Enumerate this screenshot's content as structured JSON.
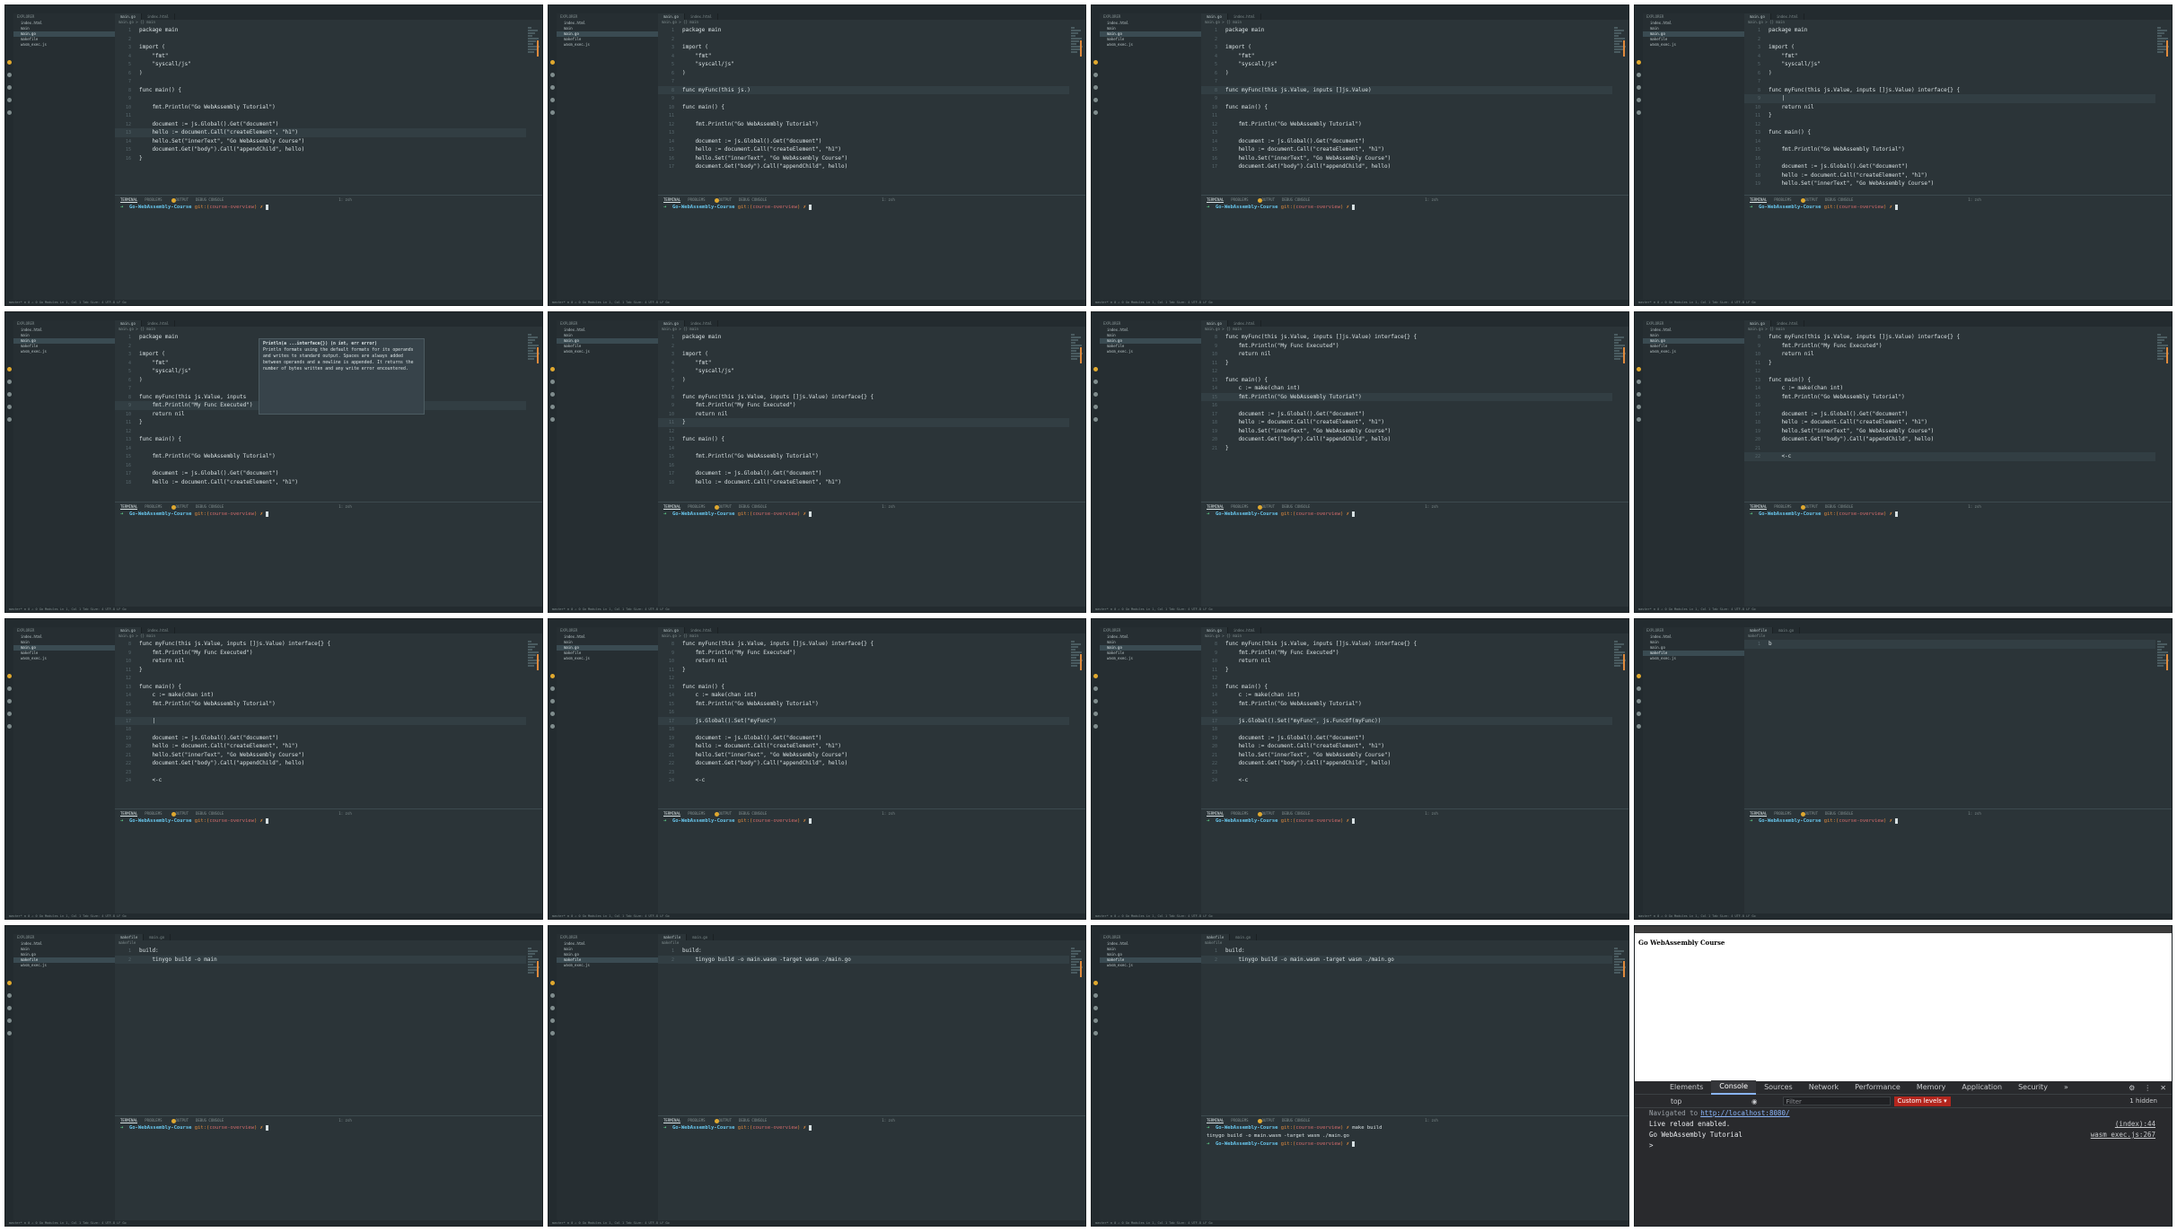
{
  "sidebar_files": [
    "index.html",
    "main",
    "main.go",
    "makefile",
    "wasm_exec.js"
  ],
  "frames": [
    {
      "tab_main": "main.go",
      "tab_other": "index.html",
      "crumbs": "main.go > {} main",
      "code": [
        {
          "n": "1",
          "t": "package main"
        },
        {
          "n": "2",
          "t": ""
        },
        {
          "n": "3",
          "t": "import ("
        },
        {
          "n": "4",
          "t": "    \"fmt\""
        },
        {
          "n": "5",
          "t": "    \"syscall/js\""
        },
        {
          "n": "6",
          "t": ")"
        },
        {
          "n": "7",
          "t": ""
        },
        {
          "n": "8",
          "t": "func main() {"
        },
        {
          "n": "9",
          "t": ""
        },
        {
          "n": "10",
          "t": "    fmt.Println(\"Go WebAssembly Tutorial\")"
        },
        {
          "n": "11",
          "t": ""
        },
        {
          "n": "12",
          "t": "    document := js.Global().Get(\"document\")"
        },
        {
          "n": "13",
          "t": "    hello := document.Call(\"createElement\", \"h1\")"
        },
        {
          "n": "14",
          "t": "    hello.Set(\"innerText\", \"Go WebAssembly Course\")"
        },
        {
          "n": "15",
          "t": "    document.Get(\"body\").Call(\"appendChild\", hello)"
        },
        {
          "n": "16",
          "t": "}"
        }
      ],
      "highlight": 13
    },
    {
      "tab_main": "main.go",
      "tab_other": "index.html",
      "crumbs": "main.go > {} main",
      "code": [
        {
          "n": "1",
          "t": "package main"
        },
        {
          "n": "2",
          "t": ""
        },
        {
          "n": "3",
          "t": "import ("
        },
        {
          "n": "4",
          "t": "    \"fmt\""
        },
        {
          "n": "5",
          "t": "    \"syscall/js\""
        },
        {
          "n": "6",
          "t": ")"
        },
        {
          "n": "7",
          "t": ""
        },
        {
          "n": "8",
          "t": "func myFunc(this js.)"
        },
        {
          "n": "9",
          "t": ""
        },
        {
          "n": "10",
          "t": "func main() {"
        },
        {
          "n": "11",
          "t": ""
        },
        {
          "n": "12",
          "t": "    fmt.Println(\"Go WebAssembly Tutorial\")"
        },
        {
          "n": "13",
          "t": ""
        },
        {
          "n": "14",
          "t": "    document := js.Global().Get(\"document\")"
        },
        {
          "n": "15",
          "t": "    hello := document.Call(\"createElement\", \"h1\")"
        },
        {
          "n": "16",
          "t": "    hello.Set(\"innerText\", \"Go WebAssembly Course\")"
        },
        {
          "n": "17",
          "t": "    document.Get(\"body\").Call(\"appendChild\", hello)"
        }
      ],
      "highlight": 8
    },
    {
      "tab_main": "main.go",
      "tab_other": "index.html",
      "crumbs": "main.go > {} main",
      "code": [
        {
          "n": "1",
          "t": "package main"
        },
        {
          "n": "2",
          "t": ""
        },
        {
          "n": "3",
          "t": "import ("
        },
        {
          "n": "4",
          "t": "    \"fmt\""
        },
        {
          "n": "5",
          "t": "    \"syscall/js\""
        },
        {
          "n": "6",
          "t": ")"
        },
        {
          "n": "7",
          "t": ""
        },
        {
          "n": "8",
          "t": "func myFunc(this js.Value, inputs []js.Value)"
        },
        {
          "n": "9",
          "t": ""
        },
        {
          "n": "10",
          "t": "func main() {"
        },
        {
          "n": "11",
          "t": ""
        },
        {
          "n": "12",
          "t": "    fmt.Println(\"Go WebAssembly Tutorial\")"
        },
        {
          "n": "13",
          "t": ""
        },
        {
          "n": "14",
          "t": "    document := js.Global().Get(\"document\")"
        },
        {
          "n": "15",
          "t": "    hello := document.Call(\"createElement\", \"h1\")"
        },
        {
          "n": "16",
          "t": "    hello.Set(\"innerText\", \"Go WebAssembly Course\")"
        },
        {
          "n": "17",
          "t": "    document.Get(\"body\").Call(\"appendChild\", hello)"
        }
      ],
      "highlight": 8
    },
    {
      "tab_main": "main.go",
      "tab_other": "index.html",
      "crumbs": "main.go > {} main",
      "code": [
        {
          "n": "1",
          "t": "package main"
        },
        {
          "n": "2",
          "t": ""
        },
        {
          "n": "3",
          "t": "import ("
        },
        {
          "n": "4",
          "t": "    \"fmt\""
        },
        {
          "n": "5",
          "t": "    \"syscall/js\""
        },
        {
          "n": "6",
          "t": ")"
        },
        {
          "n": "7",
          "t": ""
        },
        {
          "n": "8",
          "t": "func myFunc(this js.Value, inputs []js.Value) interface{} {"
        },
        {
          "n": "9",
          "t": "    |"
        },
        {
          "n": "10",
          "t": "    return nil"
        },
        {
          "n": "11",
          "t": "}"
        },
        {
          "n": "12",
          "t": ""
        },
        {
          "n": "13",
          "t": "func main() {"
        },
        {
          "n": "14",
          "t": ""
        },
        {
          "n": "15",
          "t": "    fmt.Println(\"Go WebAssembly Tutorial\")"
        },
        {
          "n": "16",
          "t": ""
        },
        {
          "n": "17",
          "t": "    document := js.Global().Get(\"document\")"
        },
        {
          "n": "18",
          "t": "    hello := document.Call(\"createElement\", \"h1\")"
        },
        {
          "n": "19",
          "t": "    hello.Set(\"innerText\", \"Go WebAssembly Course\")"
        }
      ],
      "highlight": 9
    },
    {
      "tab_main": "main.go",
      "tab_other": "index.html",
      "crumbs": "main.go > {} main",
      "code": [
        {
          "n": "1",
          "t": "package main"
        },
        {
          "n": "2",
          "t": ""
        },
        {
          "n": "3",
          "t": "import ("
        },
        {
          "n": "4",
          "t": "    \"fmt\""
        },
        {
          "n": "5",
          "t": "    \"syscall/js\""
        },
        {
          "n": "6",
          "t": ")"
        },
        {
          "n": "7",
          "t": ""
        },
        {
          "n": "8",
          "t": "func myFunc(this js.Value, inputs"
        },
        {
          "n": "9",
          "t": "    fmt.Println(\"My Func Executed\")"
        },
        {
          "n": "10",
          "t": "    return nil"
        },
        {
          "n": "11",
          "t": "}"
        },
        {
          "n": "12",
          "t": ""
        },
        {
          "n": "13",
          "t": "func main() {"
        },
        {
          "n": "14",
          "t": ""
        },
        {
          "n": "15",
          "t": "    fmt.Println(\"Go WebAssembly Tutorial\")"
        },
        {
          "n": "16",
          "t": ""
        },
        {
          "n": "17",
          "t": "    document := js.Global().Get(\"document\")"
        },
        {
          "n": "18",
          "t": "    hello := document.Call(\"createElement\", \"h1\")"
        }
      ],
      "highlight": 9,
      "tooltip": {
        "signature": "Println(a ...interface{}) (n int, err error)",
        "body": "Println formats using the default formats for its operands and writes to standard output. Spaces are always added between operands and a newline is appended. It returns the number of bytes written and any write error encountered."
      }
    },
    {
      "tab_main": "main.go",
      "tab_other": "index.html",
      "crumbs": "main.go > {} main",
      "code": [
        {
          "n": "1",
          "t": "package main"
        },
        {
          "n": "2",
          "t": ""
        },
        {
          "n": "3",
          "t": "import ("
        },
        {
          "n": "4",
          "t": "    \"fmt\""
        },
        {
          "n": "5",
          "t": "    \"syscall/js\""
        },
        {
          "n": "6",
          "t": ")"
        },
        {
          "n": "7",
          "t": ""
        },
        {
          "n": "8",
          "t": "func myFunc(this js.Value, inputs []js.Value) interface{} {"
        },
        {
          "n": "9",
          "t": "    fmt.Println(\"My Func Executed\")"
        },
        {
          "n": "10",
          "t": "    return nil"
        },
        {
          "n": "11",
          "t": "}"
        },
        {
          "n": "12",
          "t": ""
        },
        {
          "n": "13",
          "t": "func main() {"
        },
        {
          "n": "14",
          "t": ""
        },
        {
          "n": "15",
          "t": "    fmt.Println(\"Go WebAssembly Tutorial\")"
        },
        {
          "n": "16",
          "t": ""
        },
        {
          "n": "17",
          "t": "    document := js.Global().Get(\"document\")"
        },
        {
          "n": "18",
          "t": "    hello := document.Call(\"createElement\", \"h1\")"
        }
      ],
      "highlight": 11
    },
    {
      "tab_main": "main.go",
      "tab_other": "index.html",
      "crumbs": "main.go > {} main",
      "code": [
        {
          "n": "8",
          "t": "func myFunc(this js.Value, inputs []js.Value) interface{} {"
        },
        {
          "n": "9",
          "t": "    fmt.Println(\"My Func Executed\")"
        },
        {
          "n": "10",
          "t": "    return nil"
        },
        {
          "n": "11",
          "t": "}"
        },
        {
          "n": "12",
          "t": ""
        },
        {
          "n": "13",
          "t": "func main() {"
        },
        {
          "n": "14",
          "t": "    c := make(chan int)"
        },
        {
          "n": "15",
          "t": "    fmt.Println(\"Go WebAssembly Tutorial\")"
        },
        {
          "n": "16",
          "t": ""
        },
        {
          "n": "17",
          "t": "    document := js.Global().Get(\"document\")"
        },
        {
          "n": "18",
          "t": "    hello := document.Call(\"createElement\", \"h1\")"
        },
        {
          "n": "19",
          "t": "    hello.Set(\"innerText\", \"Go WebAssembly Course\")"
        },
        {
          "n": "20",
          "t": "    document.Get(\"body\").Call(\"appendChild\", hello)"
        },
        {
          "n": "21",
          "t": "}"
        }
      ],
      "highlight": 15
    },
    {
      "tab_main": "main.go",
      "tab_other": "index.html",
      "crumbs": "main.go > {} main",
      "code": [
        {
          "n": "8",
          "t": "func myFunc(this js.Value, inputs []js.Value) interface{} {"
        },
        {
          "n": "9",
          "t": "    fmt.Println(\"My Func Executed\")"
        },
        {
          "n": "10",
          "t": "    return nil"
        },
        {
          "n": "11",
          "t": "}"
        },
        {
          "n": "12",
          "t": ""
        },
        {
          "n": "13",
          "t": "func main() {"
        },
        {
          "n": "14",
          "t": "    c := make(chan int)"
        },
        {
          "n": "15",
          "t": "    fmt.Println(\"Go WebAssembly Tutorial\")"
        },
        {
          "n": "16",
          "t": ""
        },
        {
          "n": "17",
          "t": "    document := js.Global().Get(\"document\")"
        },
        {
          "n": "18",
          "t": "    hello := document.Call(\"createElement\", \"h1\")"
        },
        {
          "n": "19",
          "t": "    hello.Set(\"innerText\", \"Go WebAssembly Course\")"
        },
        {
          "n": "20",
          "t": "    document.Get(\"body\").Call(\"appendChild\", hello)"
        },
        {
          "n": "21",
          "t": ""
        },
        {
          "n": "22",
          "t": "    <-c"
        }
      ],
      "highlight": 22
    },
    {
      "tab_main": "main.go",
      "tab_other": "index.html",
      "crumbs": "main.go > {} main",
      "code": [
        {
          "n": "8",
          "t": "func myFunc(this js.Value, inputs []js.Value) interface{} {"
        },
        {
          "n": "9",
          "t": "    fmt.Println(\"My Func Executed\")"
        },
        {
          "n": "10",
          "t": "    return nil"
        },
        {
          "n": "11",
          "t": "}"
        },
        {
          "n": "12",
          "t": ""
        },
        {
          "n": "13",
          "t": "func main() {"
        },
        {
          "n": "14",
          "t": "    c := make(chan int)"
        },
        {
          "n": "15",
          "t": "    fmt.Println(\"Go WebAssembly Tutorial\")"
        },
        {
          "n": "16",
          "t": ""
        },
        {
          "n": "17",
          "t": "    |"
        },
        {
          "n": "18",
          "t": ""
        },
        {
          "n": "19",
          "t": "    document := js.Global().Get(\"document\")"
        },
        {
          "n": "20",
          "t": "    hello := document.Call(\"createElement\", \"h1\")"
        },
        {
          "n": "21",
          "t": "    hello.Set(\"innerText\", \"Go WebAssembly Course\")"
        },
        {
          "n": "22",
          "t": "    document.Get(\"body\").Call(\"appendChild\", hello)"
        },
        {
          "n": "23",
          "t": ""
        },
        {
          "n": "24",
          "t": "    <-c"
        }
      ],
      "highlight": 17
    },
    {
      "tab_main": "main.go",
      "tab_other": "index.html",
      "crumbs": "main.go > {} main",
      "code": [
        {
          "n": "8",
          "t": "func myFunc(this js.Value, inputs []js.Value) interface{} {"
        },
        {
          "n": "9",
          "t": "    fmt.Println(\"My Func Executed\")"
        },
        {
          "n": "10",
          "t": "    return nil"
        },
        {
          "n": "11",
          "t": "}"
        },
        {
          "n": "12",
          "t": ""
        },
        {
          "n": "13",
          "t": "func main() {"
        },
        {
          "n": "14",
          "t": "    c := make(chan int)"
        },
        {
          "n": "15",
          "t": "    fmt.Println(\"Go WebAssembly Tutorial\")"
        },
        {
          "n": "16",
          "t": ""
        },
        {
          "n": "17",
          "t": "    js.Global().Set(\"myFunc\")"
        },
        {
          "n": "18",
          "t": ""
        },
        {
          "n": "19",
          "t": "    document := js.Global().Get(\"document\")"
        },
        {
          "n": "20",
          "t": "    hello := document.Call(\"createElement\", \"h1\")"
        },
        {
          "n": "21",
          "t": "    hello.Set(\"innerText\", \"Go WebAssembly Course\")"
        },
        {
          "n": "22",
          "t": "    document.Get(\"body\").Call(\"appendChild\", hello)"
        },
        {
          "n": "23",
          "t": ""
        },
        {
          "n": "24",
          "t": "    <-c"
        }
      ],
      "highlight": 17
    },
    {
      "tab_main": "main.go",
      "tab_other": "index.html",
      "crumbs": "main.go > {} main",
      "code": [
        {
          "n": "8",
          "t": "func myFunc(this js.Value, inputs []js.Value) interface{} {"
        },
        {
          "n": "9",
          "t": "    fmt.Println(\"My Func Executed\")"
        },
        {
          "n": "10",
          "t": "    return nil"
        },
        {
          "n": "11",
          "t": "}"
        },
        {
          "n": "12",
          "t": ""
        },
        {
          "n": "13",
          "t": "func main() {"
        },
        {
          "n": "14",
          "t": "    c := make(chan int)"
        },
        {
          "n": "15",
          "t": "    fmt.Println(\"Go WebAssembly Tutorial\")"
        },
        {
          "n": "16",
          "t": ""
        },
        {
          "n": "17",
          "t": "    js.Global().Set(\"myFunc\", js.FuncOf(myFunc))"
        },
        {
          "n": "18",
          "t": ""
        },
        {
          "n": "19",
          "t": "    document := js.Global().Get(\"document\")"
        },
        {
          "n": "20",
          "t": "    hello := document.Call(\"createElement\", \"h1\")"
        },
        {
          "n": "21",
          "t": "    hello.Set(\"innerText\", \"Go WebAssembly Course\")"
        },
        {
          "n": "22",
          "t": "    document.Get(\"body\").Call(\"appendChild\", hello)"
        },
        {
          "n": "23",
          "t": ""
        },
        {
          "n": "24",
          "t": "    <-c"
        }
      ],
      "highlight": 17
    },
    {
      "tab_main": "makefile",
      "tab_other": "main.go",
      "crumbs": "makefile",
      "code": [
        {
          "n": "1",
          "t": "b"
        }
      ],
      "highlight": 1
    },
    {
      "tab_main": "makefile",
      "tab_other": "main.go",
      "crumbs": "makefile",
      "code": [
        {
          "n": "1",
          "t": "build:"
        },
        {
          "n": "2",
          "t": "    tinygo build -o main"
        }
      ],
      "highlight": 2
    },
    {
      "tab_main": "makefile",
      "tab_other": "main.go",
      "crumbs": "makefile",
      "code": [
        {
          "n": "1",
          "t": "build:"
        },
        {
          "n": "2",
          "t": "    tinygo build -o main.wasm -target wasm ./main.go"
        }
      ],
      "highlight": 2
    },
    {
      "tab_main": "makefile",
      "tab_other": "main.go",
      "crumbs": "makefile",
      "code": [
        {
          "n": "1",
          "t": "build:"
        },
        {
          "n": "2",
          "t": "    tinygo build -o main.wasm -target wasm ./main.go"
        }
      ],
      "highlight": 2,
      "extra_term": [
        "make build",
        "tinygo build -o main.wasm -target wasm ./main.go"
      ]
    }
  ],
  "terminal": {
    "tabs": [
      "TERMINAL",
      "PROBLEMS",
      "OUTPUT",
      "DEBUG CONSOLE"
    ],
    "shell": "1: zsh",
    "prompt_dir": "Go-WebAssembly-Course",
    "prompt_git": "git:(",
    "prompt_branch": "course-overview",
    "prompt_close": ")",
    "prompt_end": "✗"
  },
  "statusbar": "master*  ⊗ 0 ⚠ 0   Go Modules   Ln 1, Col 1   Tab Size: 4   UTF-8   LF   Go",
  "browser": {
    "page_heading": "Go WebAssembly Course",
    "devtools_tabs": [
      "Elements",
      "Console",
      "Sources",
      "Network",
      "Performance",
      "Memory",
      "Application",
      "Security",
      "»"
    ],
    "active_tab": "Console",
    "context": "top",
    "filter_placeholder": "Filter",
    "levels": "Custom levels ▾",
    "hidden": "1 hidden",
    "navigated_label": "Navigated to",
    "navigated_url": "http://localhost:8080/",
    "log1": "Live reload enabled.",
    "log1_src": "(index):44",
    "log2": "Go WebAssembly Tutorial",
    "log2_src": "wasm_exec.js:267",
    "prompt": ">"
  }
}
